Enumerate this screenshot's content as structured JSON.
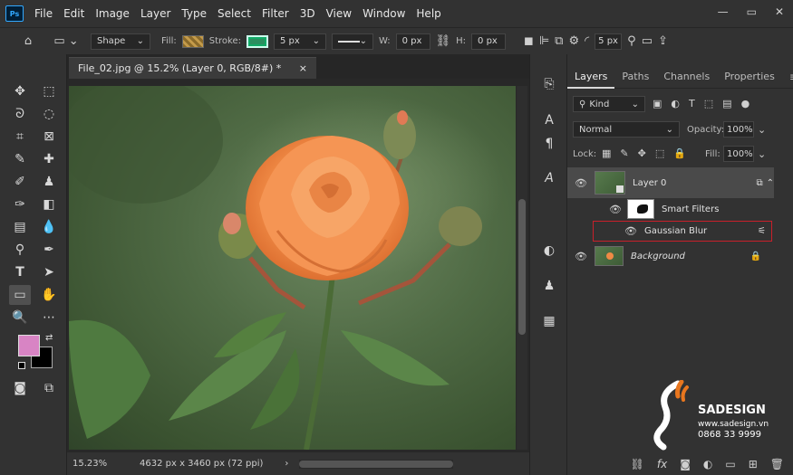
{
  "app": {
    "logo_text": "Ps"
  },
  "menu": [
    "File",
    "Edit",
    "Image",
    "Layer",
    "Type",
    "Select",
    "Filter",
    "3D",
    "View",
    "Window",
    "Help"
  ],
  "window_controls": {
    "minimize": "—",
    "restore": "▭",
    "close": "✕"
  },
  "options_bar": {
    "mode": "Shape",
    "fill_label": "Fill:",
    "stroke_label": "Stroke:",
    "stroke_size": "5 px",
    "w_label": "W:",
    "w_value": "0 px",
    "h_label": "H:",
    "h_value": "0 px",
    "radius": "5 px"
  },
  "document": {
    "tab_title": "File_02.jpg @ 15.2% (Layer 0, RGB/8#) *",
    "close": "×"
  },
  "status": {
    "zoom": "15.23%",
    "info": "4632 px x 3460 px (72 ppi)"
  },
  "layers_panel": {
    "tabs": [
      "Layers",
      "Paths",
      "Channels",
      "Properties"
    ],
    "kind_filter": "Kind",
    "blend_mode": "Normal",
    "opacity_label": "Opacity:",
    "opacity_value": "100%",
    "lock_label": "Lock:",
    "fill_label": "Fill:",
    "fill_value": "100%",
    "layers": [
      {
        "name": "Layer 0"
      },
      {
        "name": "Smart Filters"
      },
      {
        "name": "Gaussian Blur"
      },
      {
        "name": "Background"
      }
    ]
  },
  "watermark": {
    "brand": "SADESIGN",
    "url": "www.sadesign.vn",
    "phone": "0868 33 9999"
  },
  "colors": {
    "foreground": "#d884c4",
    "background": "#000000",
    "accent": "#e8761e",
    "highlight_border": "#c8202a"
  }
}
